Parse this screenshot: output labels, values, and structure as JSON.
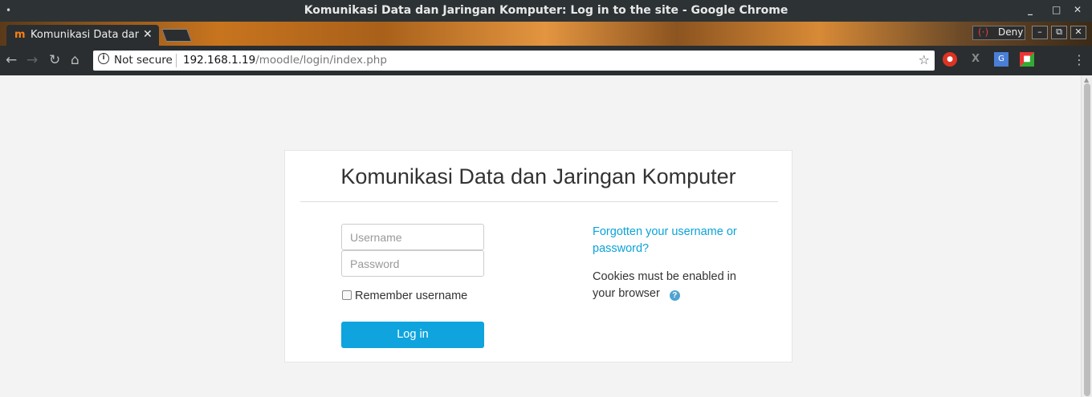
{
  "window": {
    "title": "Komunikasi Data dan Jaringan Komputer: Log in to the site - Google Chrome",
    "minimize": "_",
    "maximize": "□",
    "close": "✕"
  },
  "tab": {
    "favicon": "m",
    "label": "Komunikasi Data dan Jaringan Komputer",
    "close": "✕"
  },
  "notification": {
    "icon": "(·)",
    "label": "Deny"
  },
  "small_buttons": [
    "–",
    "⧉",
    "✕"
  ],
  "toolbar": {
    "back": "←",
    "forward": "→",
    "reload": "↻",
    "home": "⌂",
    "security_icon": "i",
    "security_label": "Not secure",
    "url_host": "192.168.1.19",
    "url_path": "/moodle/login/index.php",
    "star": "☆",
    "menu": "⋮"
  },
  "extensions": [
    "stop-icon",
    "x-icon",
    "translate-icon",
    "colorful-icon"
  ],
  "login": {
    "heading": "Komunikasi Data dan Jaringan Komputer",
    "username_placeholder": "Username",
    "password_placeholder": "Password",
    "remember_label": "Remember username",
    "button_label": "Log in",
    "forgot_link": "Forgotten your username or password?",
    "cookies_text": "Cookies must be enabled in your browser",
    "help_icon": "?"
  },
  "colors": {
    "accent": "#0fa4dd",
    "link": "#0aa3d8",
    "page_bg": "#f3f3f3"
  }
}
